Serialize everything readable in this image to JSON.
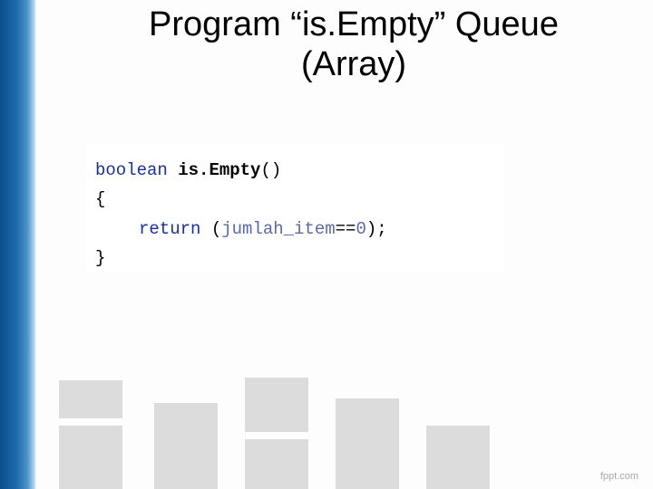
{
  "title": {
    "line1": "Program “is.Empty” Queue",
    "line2": "(Array)"
  },
  "code": {
    "ret_type": "boolean",
    "fn_name": "is.Empty",
    "parens": "()",
    "open_brace": "{",
    "return_kw": "return",
    "expr_open": " (",
    "var": "jumlah_item",
    "cmp": "==",
    "zero": "0",
    "expr_close": ");",
    "close_brace": "}"
  },
  "footer": "fppt.com"
}
